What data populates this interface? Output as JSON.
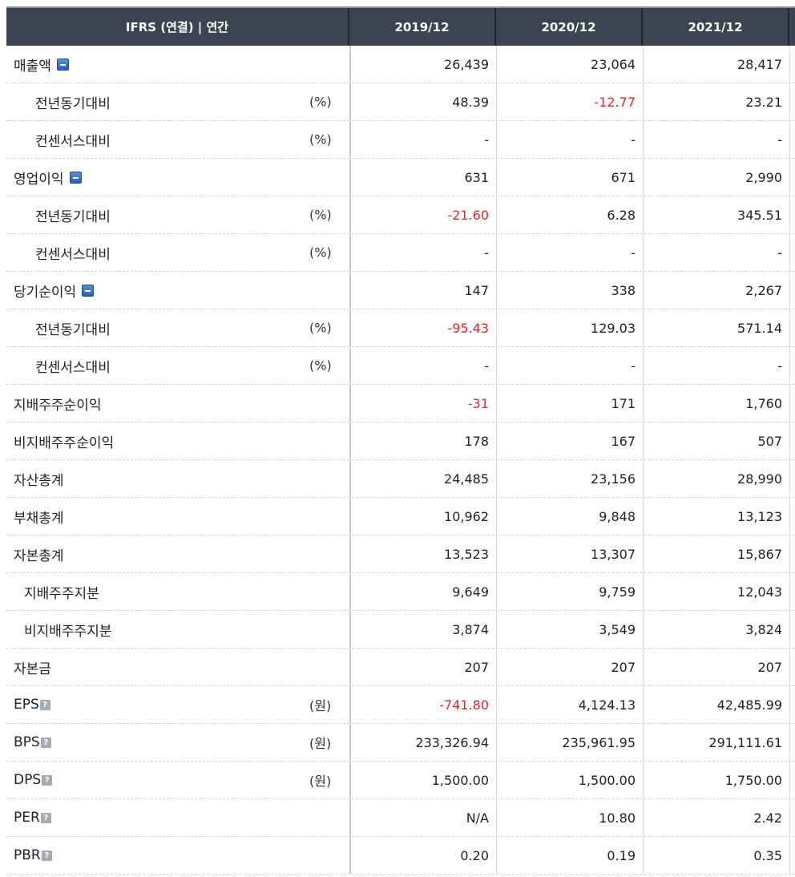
{
  "header": {
    "label": "IFRS (연결) | 연간",
    "columns": [
      "2019/12",
      "2020/12",
      "2021/12"
    ]
  },
  "rows": [
    {
      "label": "매출액",
      "unit": "",
      "values": [
        "26,439",
        "23,064",
        "28,417"
      ]
    },
    {
      "label": "전년동기대비",
      "unit": "(%)",
      "values": [
        "48.39",
        "-12.77",
        "23.21"
      ]
    },
    {
      "label": "컨센서스대비",
      "unit": "(%)",
      "values": [
        "-",
        "-",
        "-"
      ]
    },
    {
      "label": "영업이익",
      "unit": "",
      "values": [
        "631",
        "671",
        "2,990"
      ]
    },
    {
      "label": "전년동기대비",
      "unit": "(%)",
      "values": [
        "-21.60",
        "6.28",
        "345.51"
      ]
    },
    {
      "label": "컨센서스대비",
      "unit": "(%)",
      "values": [
        "-",
        "-",
        "-"
      ]
    },
    {
      "label": "당기순이익",
      "unit": "",
      "values": [
        "147",
        "338",
        "2,267"
      ]
    },
    {
      "label": "전년동기대비",
      "unit": "(%)",
      "values": [
        "-95.43",
        "129.03",
        "571.14"
      ]
    },
    {
      "label": "컨센서스대비",
      "unit": "(%)",
      "values": [
        "-",
        "-",
        "-"
      ]
    },
    {
      "label": "지배주주순이익",
      "unit": "",
      "values": [
        "-31",
        "171",
        "1,760"
      ]
    },
    {
      "label": "비지배주주순이익",
      "unit": "",
      "values": [
        "178",
        "167",
        "507"
      ]
    },
    {
      "label": "자산총계",
      "unit": "",
      "values": [
        "24,485",
        "23,156",
        "28,990"
      ]
    },
    {
      "label": "부채총계",
      "unit": "",
      "values": [
        "10,962",
        "9,848",
        "13,123"
      ]
    },
    {
      "label": "자본총계",
      "unit": "",
      "values": [
        "13,523",
        "13,307",
        "15,867"
      ]
    },
    {
      "label": "지배주주지분",
      "unit": "",
      "values": [
        "9,649",
        "9,759",
        "12,043"
      ]
    },
    {
      "label": "비지배주주지분",
      "unit": "",
      "values": [
        "3,874",
        "3,549",
        "3,824"
      ]
    },
    {
      "label": "자본금",
      "unit": "",
      "values": [
        "207",
        "207",
        "207"
      ]
    },
    {
      "label": "EPS",
      "unit": "(원)",
      "values": [
        "-741.80",
        "4,124.13",
        "42,485.99"
      ]
    },
    {
      "label": "BPS",
      "unit": "(원)",
      "values": [
        "233,326.94",
        "235,961.95",
        "291,111.61"
      ]
    },
    {
      "label": "DPS",
      "unit": "(원)",
      "values": [
        "1,500.00",
        "1,500.00",
        "1,750.00"
      ]
    },
    {
      "label": "PER",
      "unit": "",
      "values": [
        "N/A",
        "10.80",
        "2.42"
      ]
    },
    {
      "label": "PBR",
      "unit": "",
      "values": [
        "0.20",
        "0.19",
        "0.35"
      ]
    }
  ],
  "icons": {
    "collapse": "minus-square-icon",
    "help": "question-icon"
  },
  "colors": {
    "header_bg": "#3c4452",
    "negative": "#e3262b",
    "collapse_icon": "#2a5fb0"
  }
}
